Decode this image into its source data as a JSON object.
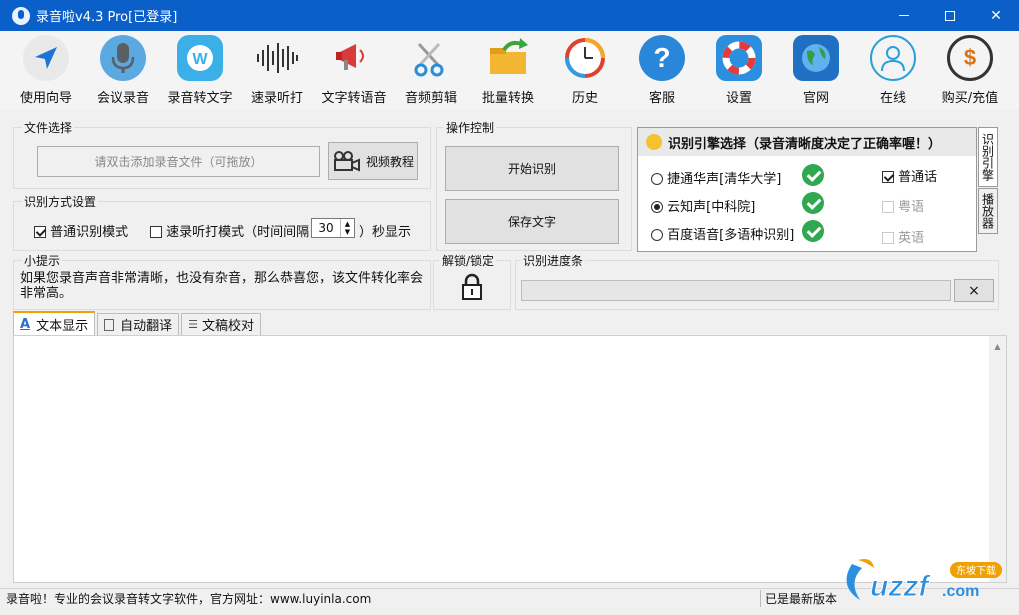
{
  "window": {
    "title": "录音啦v4.3 Pro[已登录]"
  },
  "toolbar": {
    "items": [
      {
        "label": "使用向导",
        "icon": "compass-arrow-icon"
      },
      {
        "label": "会议录音",
        "icon": "microphone-icon"
      },
      {
        "label": "录音转文字",
        "icon": "w-badge-icon"
      },
      {
        "label": "速录听打",
        "icon": "soundwave-icon"
      },
      {
        "label": "文字转语音",
        "icon": "megaphone-icon"
      },
      {
        "label": "音频剪辑",
        "icon": "scissors-icon"
      },
      {
        "label": "批量转换",
        "icon": "folder-arrow-icon"
      },
      {
        "label": "历史",
        "icon": "history-clock-icon"
      },
      {
        "label": "客服",
        "icon": "help-icon"
      },
      {
        "label": "设置",
        "icon": "lifebuoy-icon"
      },
      {
        "label": "官网",
        "icon": "globe-icon"
      },
      {
        "label": "在线",
        "icon": "user-online-icon"
      },
      {
        "label": "购买/充值",
        "icon": "dollar-cursor-icon"
      }
    ]
  },
  "file_select": {
    "group_label": "文件选择",
    "add_file_label": "请双击添加录音文件（可拖放）",
    "video_tutorial_label": "视频教程"
  },
  "recognition_mode": {
    "group_label": "识别方式设置",
    "normal_mode_label": "普通识别模式",
    "normal_mode_checked": true,
    "dictation_mode_label": "速录听打模式（时间间隔",
    "dictation_mode_checked": false,
    "interval_value": "30",
    "interval_suffix": "）秒显示"
  },
  "operation": {
    "group_label": "操作控制",
    "start_label": "开始识别",
    "save_label": "保存文字"
  },
  "engine": {
    "header": "识别引擎选择（录音清晰度决定了正确率喔！）",
    "options": [
      {
        "label": "捷通华声[清华大学]",
        "selected": false
      },
      {
        "label": "云知声[中科院]",
        "selected": true
      },
      {
        "label": "百度语音[多语种识别]",
        "selected": false
      }
    ],
    "languages": [
      {
        "label": "普通话",
        "checked": true,
        "enabled": true
      },
      {
        "label": "粤语",
        "checked": false,
        "enabled": false
      },
      {
        "label": "英语",
        "checked": false,
        "enabled": false
      }
    ],
    "side_tabs": [
      "识别引擎",
      "播放器"
    ]
  },
  "tips": {
    "group_label": "小提示",
    "text": "如果您录音声音非常清晰，也没有杂音，那么恭喜您，该文件转化率会非常高。"
  },
  "lock": {
    "group_label": "解锁/锁定"
  },
  "progress": {
    "group_label": "识别进度条",
    "value": 0,
    "close_label": "×"
  },
  "tabs": [
    {
      "label": "文本显示",
      "active": true
    },
    {
      "label": "自动翻译",
      "active": false
    },
    {
      "label": "文稿校对",
      "active": false
    }
  ],
  "status": {
    "left": "录音啦！专业的会议录音转文字软件，官方网址：www.luyinla.com",
    "right": "已是最新版本"
  },
  "watermark": {
    "text": "uzzf.com",
    "badge": "东坡下载"
  },
  "colors": {
    "titlebar": "#0a5fc9",
    "accent_tab": "#f0a000",
    "check_green": "#2fa84f"
  }
}
